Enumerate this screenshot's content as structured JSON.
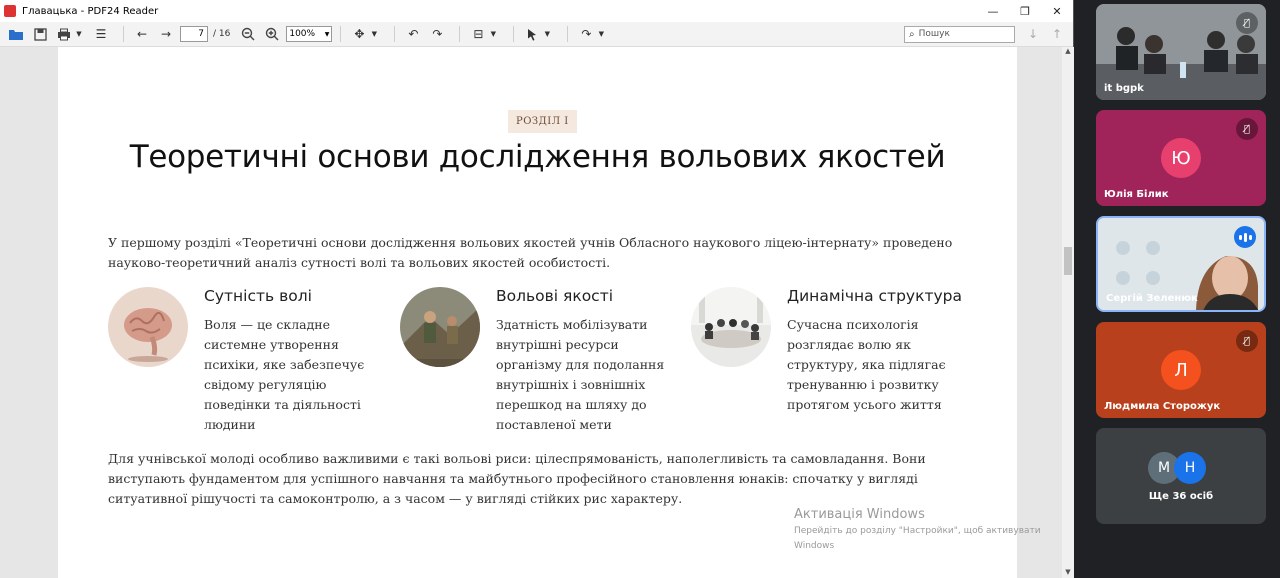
{
  "window": {
    "title": "Главацька - PDF24 Reader",
    "minimize": "—",
    "maximize": "❐",
    "close": "✕"
  },
  "toolbar": {
    "open_icon": "📂",
    "save_icon": "💾",
    "print_icon": "🖶",
    "list_icon": "☰",
    "back": "←",
    "forward": "→",
    "page_current": "7",
    "page_total": "/ 16",
    "zoom_out": "−",
    "zoom_in": "+",
    "zoom_value": "100%",
    "move": "✥",
    "undo": "↶",
    "redo": "↷",
    "fit": "⊟",
    "select": "➤",
    "share": "↷",
    "search_placeholder": "Пошук",
    "down": "↓",
    "up": "↑"
  },
  "document": {
    "badge": "РОЗДІЛ І",
    "heading": "Теоретичні основи дослідження вольових якостей",
    "intro": "У першому розділі «Теоретичні основи дослідження вольових якостей учнів Обласного наукового ліцею-інтернату» проведено науково-теоретичний аналіз сутності волі та вольових якостей особистості.",
    "features": [
      {
        "title": "Сутність волі",
        "text": "Воля — це складне системне утворення психіки, яке забезпечує свідому регуляцію поведінки та діяльності людини"
      },
      {
        "title": "Вольові якості",
        "text": "Здатність мобілізувати внутрішні ресурси організму для подолання внутрішніх і зовнішніх перешкод на шляху до поставленої мети"
      },
      {
        "title": "Динамічна структура",
        "text": "Сучасна психологія розглядає волю як структуру, яка підлягає тренуванню і розвитку протягом усього життя"
      }
    ],
    "outro": "Для учнівської молоді особливо важливими є такі вольові риси: цілеспрямованість, наполегливість та самовладання. Вони виступають фундаментом для успішного навчання та майбутнього професійного становлення юнаків: спочатку у вигляді ситуативної рішучості та самоконтролю, а з часом — у вигляді стійких рис характеру."
  },
  "watermark": {
    "line1": "Активація Windows",
    "line2": "Перейдіть до розділу \"Настройки\", щоб активувати Windows"
  },
  "meeting": {
    "participants": [
      {
        "name": "it bgpk",
        "type": "video",
        "muted": true
      },
      {
        "name": "Юлія Білик",
        "initial": "Ю",
        "avatar_color": "#e8406e",
        "tile_color": "#a0245a",
        "muted": true
      },
      {
        "name": "Сергій Зеленюк",
        "type": "video",
        "speaking": true
      },
      {
        "name": "Людмила Сторожук",
        "initial": "Л",
        "avatar_color": "#f4511e",
        "tile_color": "#b8401c",
        "muted": true
      }
    ],
    "others": {
      "label": "Ще 36 осіб",
      "initials": [
        "М",
        "Н"
      ],
      "colors": [
        "#5f6f7a",
        "#1a73e8"
      ]
    }
  }
}
